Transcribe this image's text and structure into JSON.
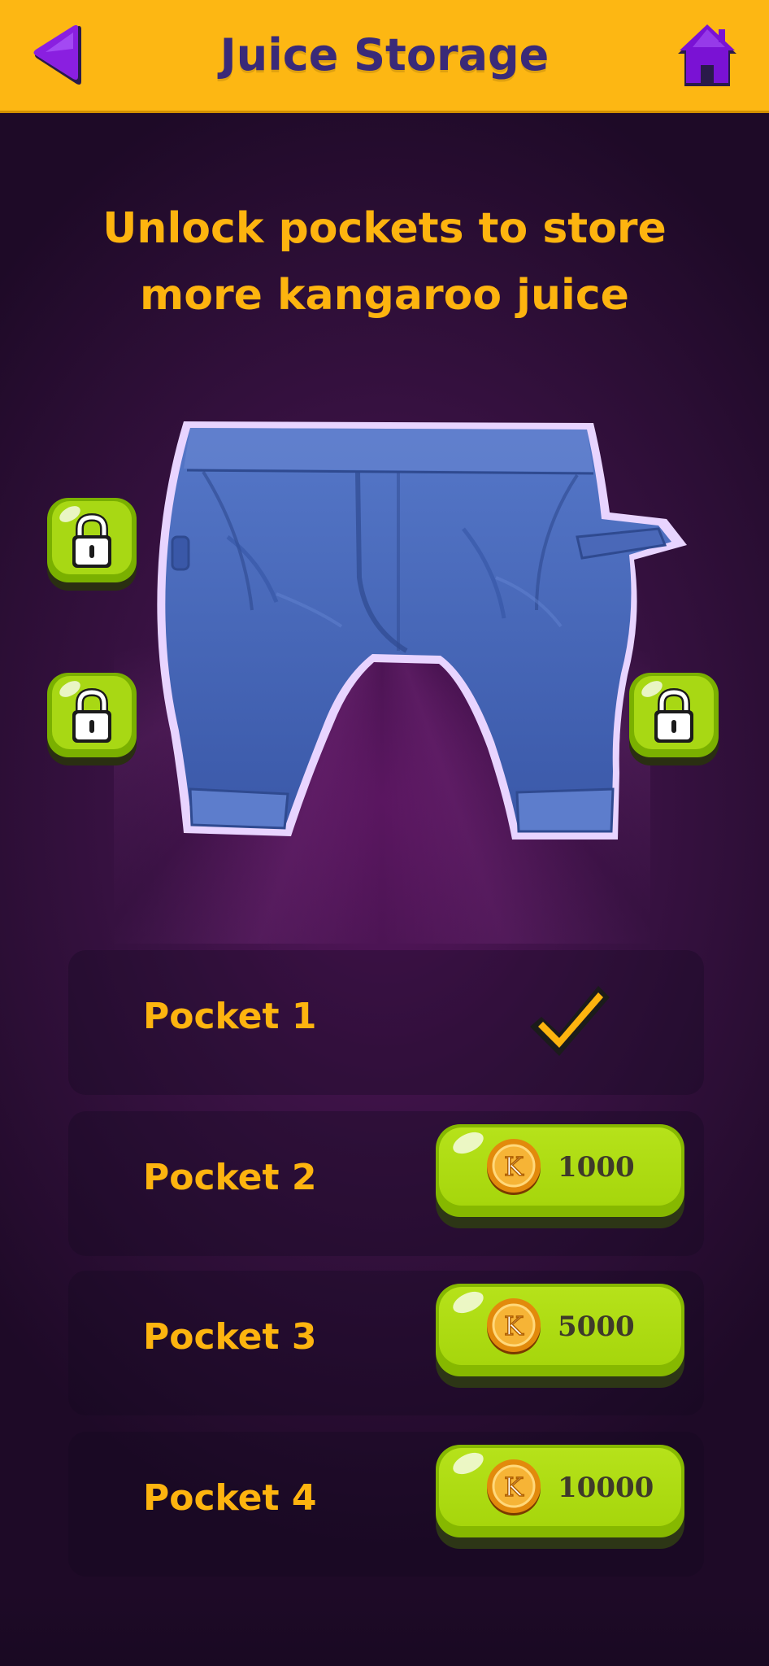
{
  "header": {
    "title": "Juice Storage",
    "back_icon": "back-arrow-icon",
    "home_icon": "home-icon",
    "colors": {
      "bar": "#fdb713",
      "icon": "#7a12d4",
      "title": "#3a2a78"
    }
  },
  "subtitle": "Unlock pockets to store more kangaroo juice",
  "pants": {
    "icon": "pants-icon",
    "locks": [
      "lock-icon",
      "lock-icon",
      "lock-icon"
    ]
  },
  "pockets": [
    {
      "label": "Pocket 1",
      "status": "unlocked",
      "icon": "checkmark-icon"
    },
    {
      "label": "Pocket 2",
      "price": "1000",
      "currency_icon": "k-coin-icon"
    },
    {
      "label": "Pocket 3",
      "price": "5000",
      "currency_icon": "k-coin-icon"
    },
    {
      "label": "Pocket 4",
      "price": "10000",
      "currency_icon": "k-coin-icon"
    }
  ],
  "colors": {
    "accent_text": "#fdb40f",
    "button_green": "#a6d60c"
  }
}
